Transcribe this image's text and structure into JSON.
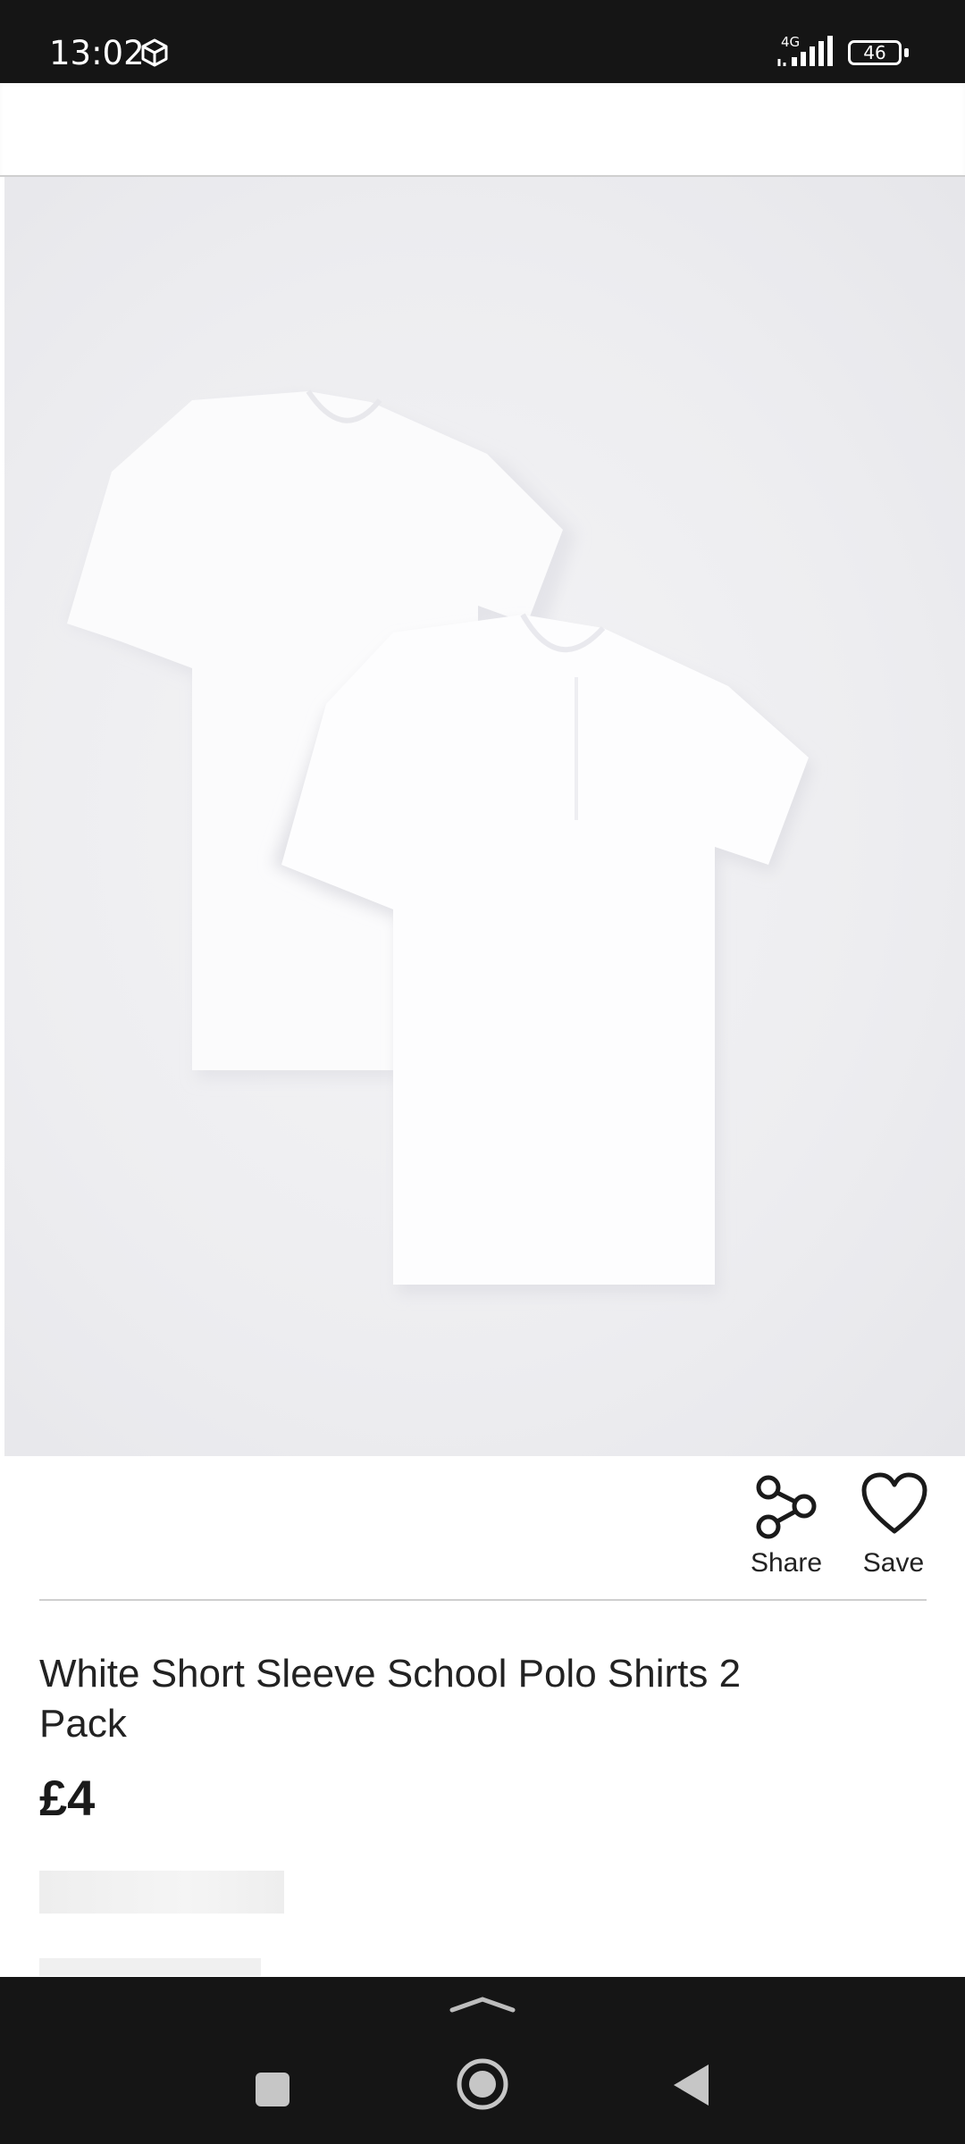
{
  "status_bar": {
    "time": "13:02",
    "network": "4G",
    "battery": "46",
    "icons": [
      "cube-icon",
      "signal-icon",
      "battery-icon"
    ]
  },
  "product": {
    "image_alt_icon": "product-photo",
    "title": "White Short Sleeve School Polo Shirts 2 Pack",
    "price": "£4"
  },
  "actions": {
    "share_label": "Share",
    "save_label": "Save",
    "share_icon": "share-icon",
    "save_icon": "heart-icon"
  },
  "colors": {
    "status_bar_bg": "#151515",
    "nav_bar_bg": "#151515",
    "divider": "#cfcfcf",
    "text": "#1a1a1a"
  },
  "nav": {
    "icons": [
      "chevron-up-icon",
      "recents-icon",
      "home-icon",
      "back-icon"
    ]
  }
}
